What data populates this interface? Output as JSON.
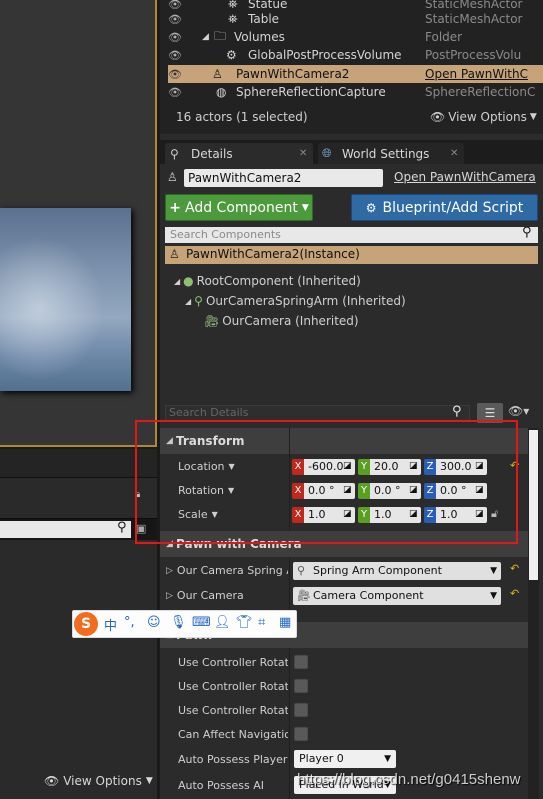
{
  "outliner": {
    "rows": [
      {
        "name": "Statue",
        "type": "StaticMeshActor",
        "icon": "static-mesh-icon"
      },
      {
        "name": "Table",
        "type": "StaticMeshActor",
        "icon": "static-mesh-icon"
      },
      {
        "name": "Volumes",
        "type": "Folder",
        "icon": "folder-icon"
      },
      {
        "name": "GlobalPostProcessVolume",
        "type": "PostProcessVolu",
        "icon": "postprocess-icon"
      },
      {
        "name": "PawnWithCamera2",
        "type": "Open PawnWithC",
        "icon": "pawn-icon"
      },
      {
        "name": "SphereReflectionCapture",
        "type": "SphereReflectionC",
        "icon": "reflection-icon"
      }
    ],
    "status": "16 actors (1 selected)",
    "view_options": "View Options"
  },
  "tabs": {
    "details": "Details",
    "world_settings": "World Settings"
  },
  "actor": {
    "name": "PawnWithCamera2",
    "open_link": "Open PawnWithCamera"
  },
  "toolbar": {
    "add_component": "Add Component",
    "blueprint_script": "Blueprint/Add Script"
  },
  "components": {
    "search_placeholder": "Search Components",
    "instance": "PawnWithCamera2(Instance)",
    "tree": [
      {
        "label": "RootComponent (Inherited)"
      },
      {
        "label": "OurCameraSpringArm (Inherited)"
      },
      {
        "label": "OurCamera (Inherited)"
      }
    ]
  },
  "details": {
    "search_placeholder": "Search Details"
  },
  "transform": {
    "header": "Transform",
    "location": {
      "label": "Location",
      "x": "-600.0",
      "y": "20.0",
      "z": "300.0"
    },
    "rotation": {
      "label": "Rotation",
      "x": "0.0 °",
      "y": "0.0 °",
      "z": "0.0 °"
    },
    "scale": {
      "label": "Scale",
      "x": "1.0",
      "y": "1.0",
      "z": "1.0"
    }
  },
  "pawn_with_camera": {
    "header": "Pawn with Camera",
    "spring_arm": {
      "label": "Our Camera Spring Arm",
      "value": "Spring Arm Component"
    },
    "camera": {
      "label": "Our Camera",
      "value": "Camera Component"
    }
  },
  "pawn": {
    "header": "Pawn",
    "use_controller_1": "Use Controller Rotation Pitch",
    "use_controller_2": "Use Controller Rotation Yaw",
    "use_controller_3": "Use Controller Rotation Roll",
    "can_affect_navigation": "Can Affect Navigation",
    "auto_possess_player": {
      "label": "Auto Possess Player",
      "value": "Player 0"
    },
    "auto_possess_ai": {
      "label": "Auto Possess AI",
      "value": "Placed in World"
    }
  },
  "left": {
    "view_options": "View Options"
  },
  "ime": {
    "logo": "S",
    "chinese": "中",
    "punct": "°,"
  },
  "watermark": "https://blog.csdn.net/g0415shenw",
  "colors": {
    "selection": "#c7a37a",
    "add_component": "#4c9a3c",
    "blueprint": "#2f6aa5",
    "axis_x": "#c0281c",
    "axis_y": "#5a9e22",
    "axis_z": "#2b5db5",
    "highlight": "#e01818"
  }
}
